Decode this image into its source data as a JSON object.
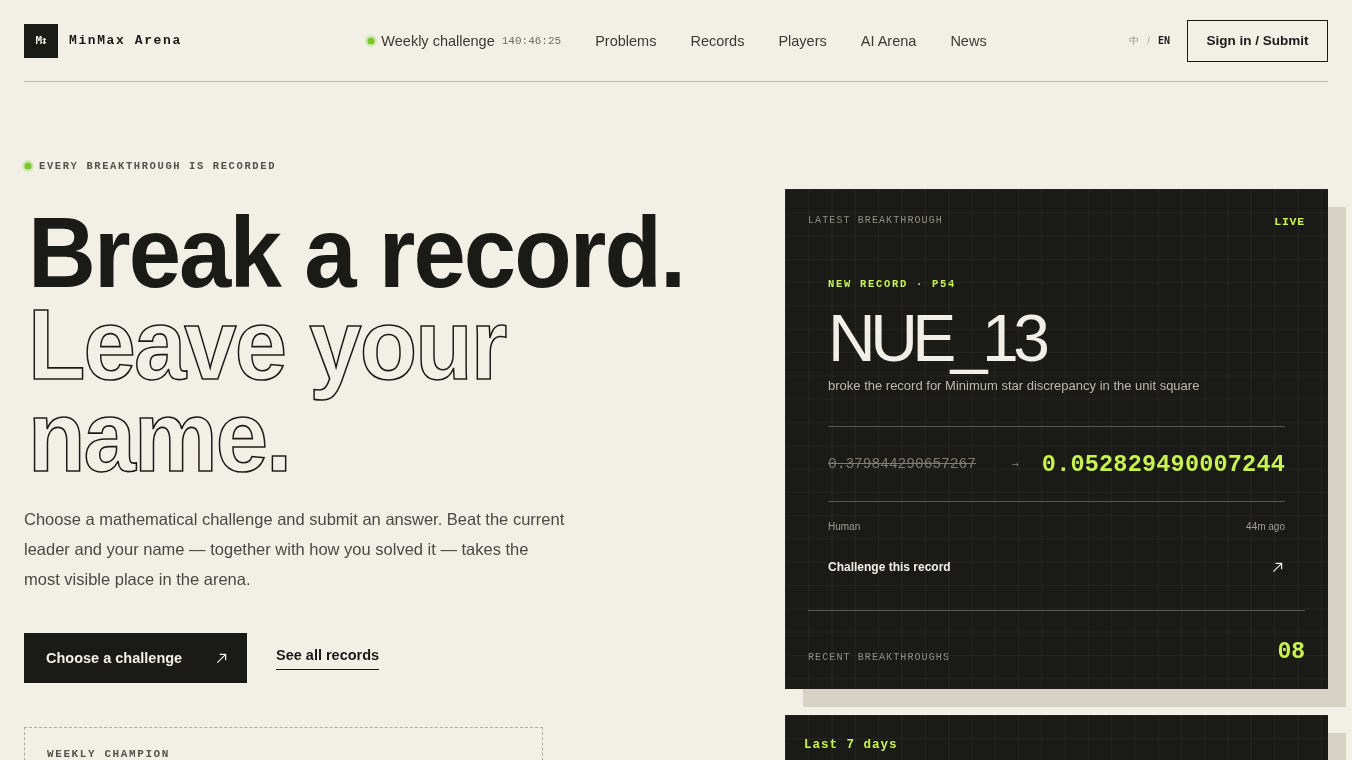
{
  "header": {
    "logo_mark": "M↕",
    "brand": "MinMax Arena",
    "weekly": {
      "label": "Weekly challenge",
      "timer": "140:46:25"
    },
    "nav": [
      "Problems",
      "Records",
      "Players",
      "AI Arena",
      "News"
    ],
    "languages": [
      {
        "label": "中",
        "selected": false
      },
      {
        "label": "EN",
        "selected": true
      }
    ],
    "language_separator": "/",
    "sign_in": "Sign in / Submit"
  },
  "hero": {
    "eyebrow": "EVERY BREAKTHROUGH IS RECORDED",
    "headline_solid": "Break a record.",
    "headline_outline": "Leave your name.",
    "description": "Choose a mathematical challenge and submit an answer. Beat the current leader and your name — together with how you solved it — takes the most visible place in the arena.",
    "primary_button": "Choose a challenge",
    "secondary_link": "See all records"
  },
  "weekly_champion": {
    "label": "WEEKLY CHAMPION"
  },
  "latest_card": {
    "label": "LATEST BREAKTHROUGH",
    "status": "LIVE",
    "tag": "NEW RECORD · P54",
    "player": "NUE_13",
    "summary": "broke the record for Minimum star discrepancy in the unit square",
    "old_value": "0.379844290657267",
    "new_value": "0.052829490007244",
    "solver_type": "Human",
    "time_ago": "44m ago",
    "challenge_link": "Challenge this record",
    "recent_label": "RECENT BREAKTHROUGHS",
    "recent_count": "08"
  },
  "week_card": {
    "label": "Last 7 days"
  }
}
